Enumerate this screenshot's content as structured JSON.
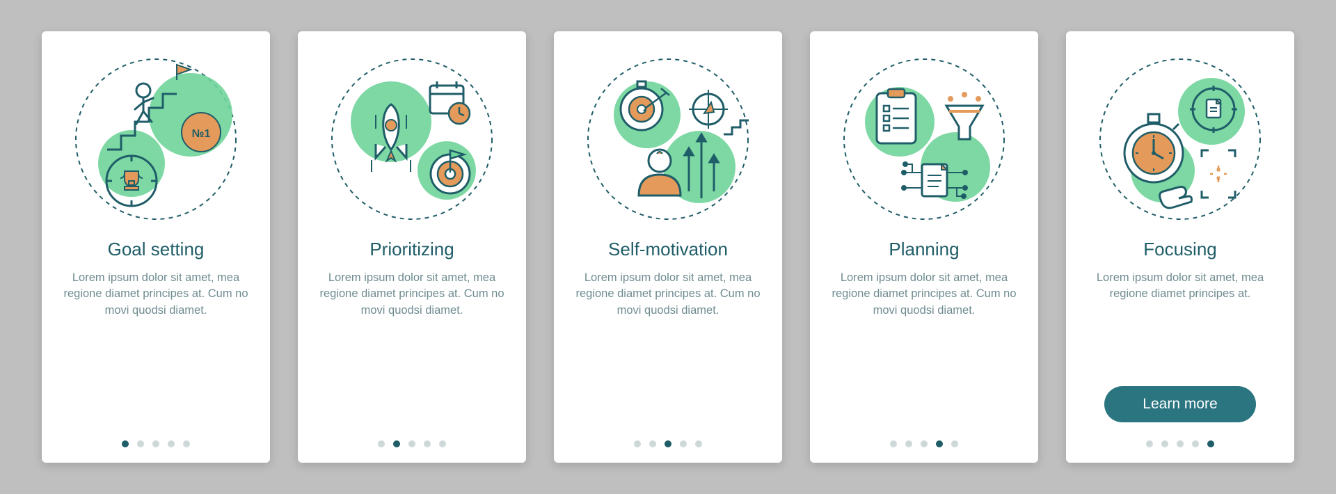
{
  "colors": {
    "accent_green": "#6fd49a",
    "accent_orange": "#e39a5a",
    "line_teal": "#1f5d68",
    "text_muted": "#6f8b90"
  },
  "pagination": {
    "total": 5
  },
  "cards": [
    {
      "title": "Goal setting",
      "desc": "Lorem ipsum dolor sit amet, mea regione diamet principes at. Cum no movi quodsi diamet.",
      "active_dot": 0,
      "has_button": false
    },
    {
      "title": "Prioritizing",
      "desc": "Lorem ipsum dolor sit amet, mea regione diamet principes at. Cum no movi quodsi diamet.",
      "active_dot": 1,
      "has_button": false
    },
    {
      "title": "Self-motivation",
      "desc": "Lorem ipsum dolor sit amet, mea regione diamet principes at. Cum no movi quodsi diamet.",
      "active_dot": 2,
      "has_button": false
    },
    {
      "title": "Planning",
      "desc": "Lorem ipsum dolor sit amet, mea regione diamet principes at. Cum no movi quodsi diamet.",
      "active_dot": 3,
      "has_button": false
    },
    {
      "title": "Focusing",
      "desc": "Lorem ipsum dolor sit amet, mea regione diamet principes at.",
      "active_dot": 4,
      "has_button": true,
      "button_label": "Learn more"
    }
  ]
}
